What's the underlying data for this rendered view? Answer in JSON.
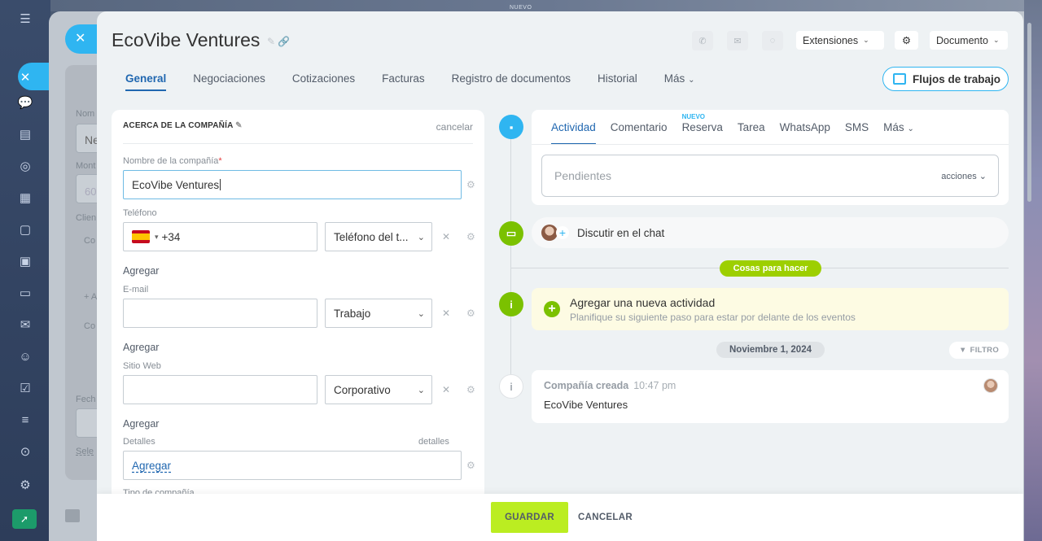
{
  "background": {
    "top_label": "NUEVO",
    "left_labels": [
      "Nom",
      "Ne",
      "Mont",
      "60",
      "Clien",
      "Co",
      "+ A",
      "Co",
      "Fech",
      "Sele"
    ]
  },
  "sidebar": {
    "icons": [
      "menu-icon",
      "chat-icon",
      "feed-icon",
      "target-icon",
      "calendar-icon",
      "document-icon",
      "presentation-icon",
      "card-icon",
      "mail-icon",
      "contacts-icon",
      "task-icon",
      "filter-icon",
      "robot-icon",
      "gear-icon",
      "rocket-icon"
    ]
  },
  "header": {
    "title": "EcoVibe Ventures",
    "extensions_label": "Extensiones",
    "document_label": "Documento",
    "workflows_label": "Flujos de trabajo"
  },
  "tabs": [
    {
      "label": "General",
      "active": true
    },
    {
      "label": "Negociaciones"
    },
    {
      "label": "Cotizaciones"
    },
    {
      "label": "Facturas"
    },
    {
      "label": "Registro de documentos"
    },
    {
      "label": "Historial"
    },
    {
      "label": "Más"
    }
  ],
  "company_card": {
    "heading": "ACERCA DE LA COMPAÑÍA",
    "cancel": "cancelar",
    "name_label": "Nombre de la compañía",
    "name_value": "EcoVibe Ventures",
    "phone_label": "Teléfono",
    "phone_value": "+34",
    "phone_type": "Teléfono del t...",
    "add": "Agregar",
    "email_label": "E-mail",
    "email_value": "",
    "email_type": "Trabajo",
    "web_label": "Sitio Web",
    "web_value": "",
    "web_type": "Corporativo",
    "details_label": "Detalles",
    "details_link": "detalles",
    "details_add": "Agregar",
    "company_type_label": "Tipo de compañía"
  },
  "activity": {
    "tabs": [
      "Actividad",
      "Comentario",
      "Reserva",
      "Tarea",
      "WhatsApp",
      "SMS",
      "Más"
    ],
    "new_badge": "NUEVO",
    "pending_placeholder": "Pendientes",
    "actions": "acciones",
    "chat_label": "Discutir en el chat",
    "todo_pill": "Cosas para hacer",
    "add_activity_title": "Agregar una nueva actividad",
    "add_activity_sub": "Planifique su siguiente paso para estar por delante de los eventos",
    "date": "Noviembre 1, 2024",
    "filter": "FILTRO",
    "history_title": "Compañía creada",
    "history_time": "10:47 pm",
    "history_body": "EcoVibe Ventures"
  },
  "footer": {
    "save": "GUARDAR",
    "cancel": "CANCELAR"
  },
  "colors": {
    "accent": "#2fb5f1",
    "active_tab": "#2067b0",
    "save": "#bbed21",
    "todo_green": "#9dcf00"
  }
}
